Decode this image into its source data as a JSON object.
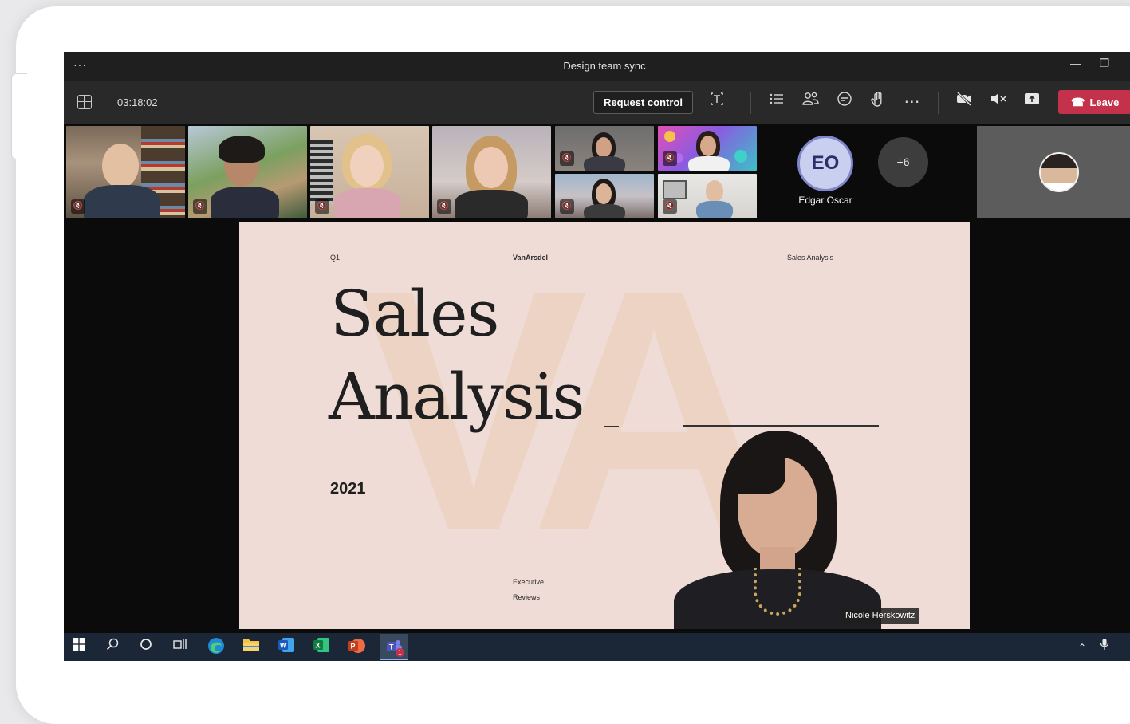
{
  "window": {
    "title": "Design team sync",
    "menu_glyph": "···"
  },
  "toolbar": {
    "timer": "03:18:02",
    "request_control_label": "Request control",
    "leave_label": "Leave"
  },
  "participants": {
    "named_avatar": {
      "initials": "EO",
      "name": "Edgar Oscar"
    },
    "overflow_count": "+6"
  },
  "slide": {
    "quarter": "Q1",
    "brand": "VanArsdel",
    "header_right": "Sales Analysis",
    "title_line1": "Sales",
    "title_line2": "Analysis",
    "year": "2021",
    "footer_line1": "Executive",
    "footer_line2": "Reviews",
    "watermark": "VA"
  },
  "presenter": {
    "name": "Nicole Herskowitz"
  },
  "colors": {
    "leave": "#c4314b",
    "toolbar_bg": "#292929",
    "slide_bg": "#efdcd6",
    "avatar_ring": "#7f86c9",
    "taskbar_bg": "#1b2736"
  },
  "icons": {
    "toolbar": [
      "grid-icon",
      "share-tray-icon",
      "chat-list-icon",
      "people-icon",
      "chat-icon",
      "reactions-icon",
      "more-icon",
      "camera-off-icon",
      "speaker-muted-icon",
      "share-screen-icon",
      "phone-hangup-icon"
    ],
    "taskbar": [
      "windows-start-icon",
      "search-icon",
      "cortana-icon",
      "task-view-icon",
      "edge-icon",
      "file-explorer-icon",
      "word-icon",
      "excel-icon",
      "powerpoint-icon",
      "teams-icon",
      "chevron-up-icon",
      "microphone-icon"
    ]
  }
}
